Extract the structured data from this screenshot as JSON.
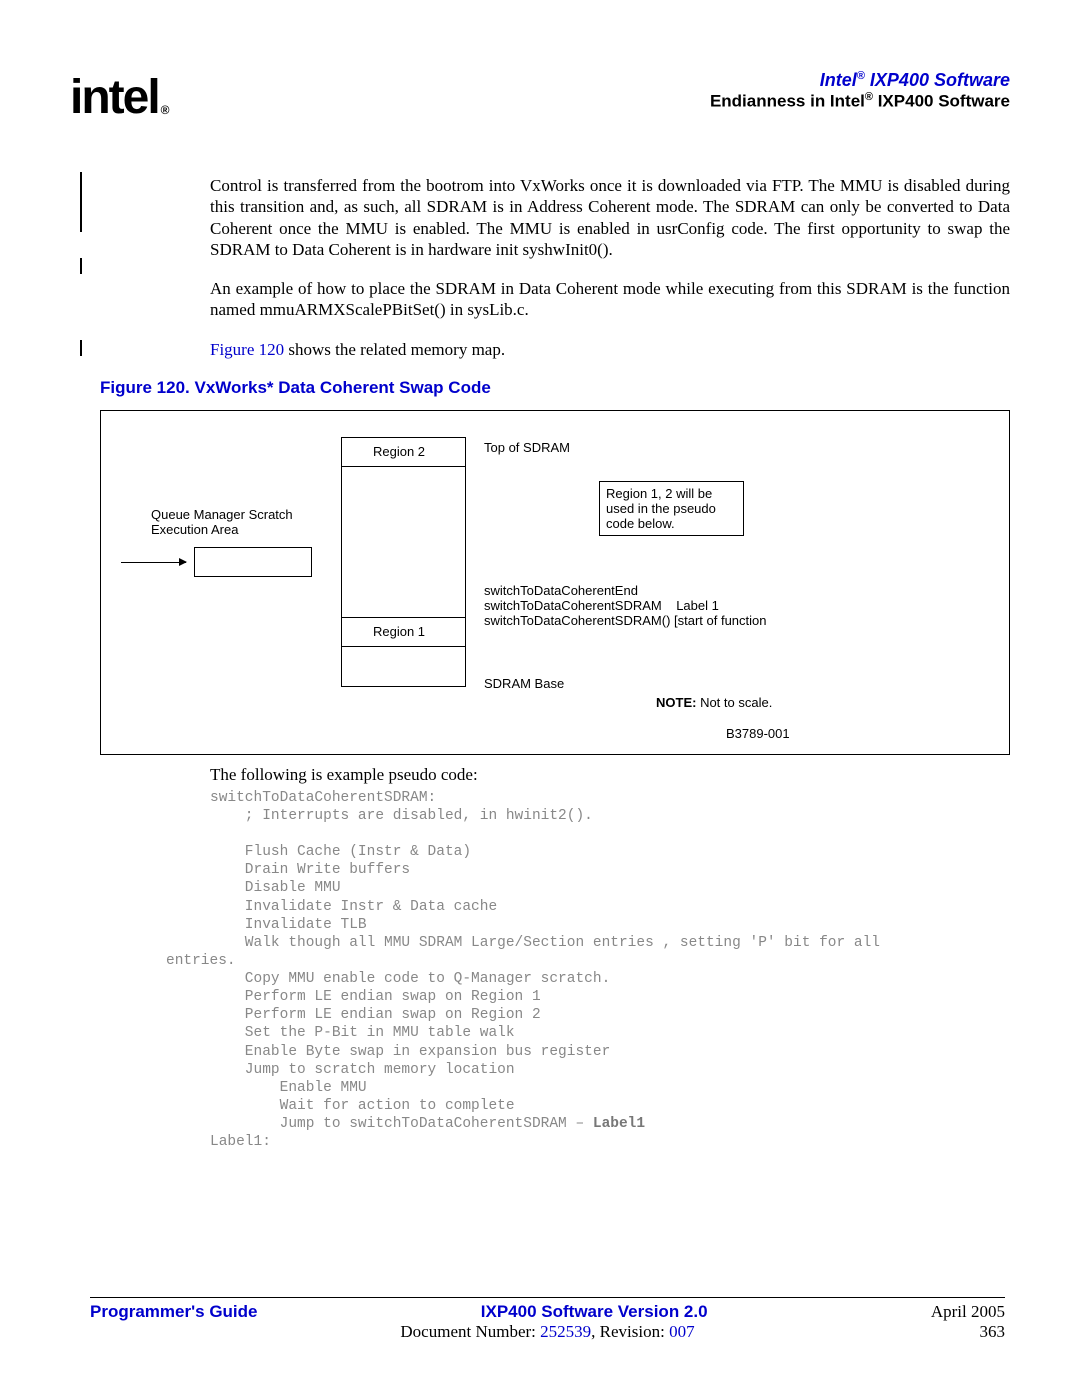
{
  "header": {
    "logo_text": "intel",
    "logo_reg": "®",
    "title_prefix": "Intel",
    "title_reg": "®",
    "title_suffix": " IXP400 Software",
    "subtitle_prefix": "Endianness in Intel",
    "subtitle_reg": "®",
    "subtitle_suffix": " IXP400 Software"
  },
  "paragraphs": {
    "p1": "Control is transferred from the bootrom into VxWorks once it is downloaded via FTP. The MMU is disabled during this transition and, as such, all SDRAM is in Address Coherent mode. The SDRAM can only be converted to Data Coherent once the MMU is enabled. The MMU is enabled in usrConfig code. The first opportunity to swap the SDRAM to Data Coherent is in hardware init syshwInit0().",
    "p2": "An example of how to place the SDRAM in Data Coherent mode while executing from this SDRAM is the function named mmuARMXScalePBitSet() in sysLib.c.",
    "p3a": "Figure 120",
    "p3b": " shows the related memory map."
  },
  "figure": {
    "title": "Figure 120. VxWorks* Data Coherent Swap Code",
    "region2": "Region 2",
    "region1": "Region 1",
    "top_sdram": "Top of SDRAM",
    "queue_label": "Queue Manager Scratch Execution Area",
    "note_box_l1": "Region 1, 2 will be",
    "note_box_l2": "used in the pseudo",
    "note_box_l3": "code below.",
    "switch_end": "switchToDataCoherentEnd",
    "switch_sdram": "switchToDataCoherentSDRAM",
    "label1": "Label 1",
    "switch_func": "switchToDataCoherentSDRAM() [start of function",
    "sdram_base": "SDRAM Base",
    "note_prefix": "NOTE:",
    "note_text": " Not to scale.",
    "diagram_id": "B3789-001"
  },
  "pseudo_intro": "The following is example pseudo code:",
  "code": {
    "l1": "switchToDataCoherentSDRAM:",
    "l2": "    ; Interrupts are disabled, in hwinit2().",
    "l3": "",
    "l4": "    Flush Cache (Instr & Data)",
    "l5": "    Drain Write buffers",
    "l6": "    Disable MMU",
    "l7": "    Invalidate Instr & Data cache",
    "l8": "    Invalidate TLB",
    "l9a": "    Walk though all MMU SDRAM Large/Section entries , setting 'P' bit for all ",
    "l9b": "entries.",
    "l10": "    Copy MMU enable code to Q-Manager scratch.",
    "l11": "    Perform LE endian swap on Region 1",
    "l12": "    Perform LE endian swap on Region 2",
    "l13": "    Set the P-Bit in MMU table walk",
    "l14": "    Enable Byte swap in expansion bus register",
    "l15": "    Jump to scratch memory location",
    "l16": "        Enable MMU",
    "l17": "        Wait for action to complete",
    "l18a": "        Jump to switchToDataCoherentSDRAM – ",
    "l18b": "Label1",
    "l19": "Label1:"
  },
  "footer": {
    "left": "Programmer's Guide",
    "center": "IXP400 Software Version 2.0",
    "right": "April 2005",
    "doc_label": "Document Number: ",
    "doc_num": "252539",
    "rev_label": ", Revision: ",
    "rev_num": "007",
    "page": "363"
  }
}
